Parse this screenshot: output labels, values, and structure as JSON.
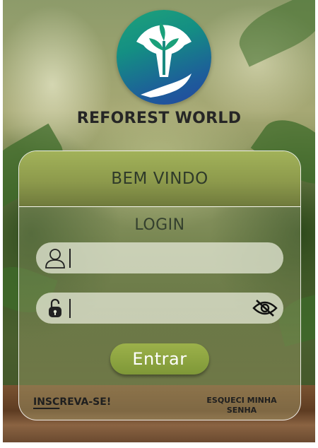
{
  "brand": {
    "name": "REFOREST WORLD"
  },
  "card": {
    "welcome": "BEM VINDO",
    "login_title": "LOGIN"
  },
  "fields": {
    "username": {
      "value": "",
      "icon": "user-icon"
    },
    "password": {
      "value": "",
      "icon": "unlocked-padlock-icon",
      "toggle_icon": "eye-slash-icon"
    }
  },
  "actions": {
    "submit_label": "Entrar",
    "signup_underlined": "INSC",
    "signup_rest": "REVA-SE!",
    "forgot_line1": "ESQUECI MINHA",
    "forgot_line2": "SENHA"
  },
  "colors": {
    "accent_button": "#8ea63f",
    "header_band": "#98a853",
    "logo_gradient_start": "#1fa27a",
    "logo_gradient_end": "#2347a0"
  }
}
